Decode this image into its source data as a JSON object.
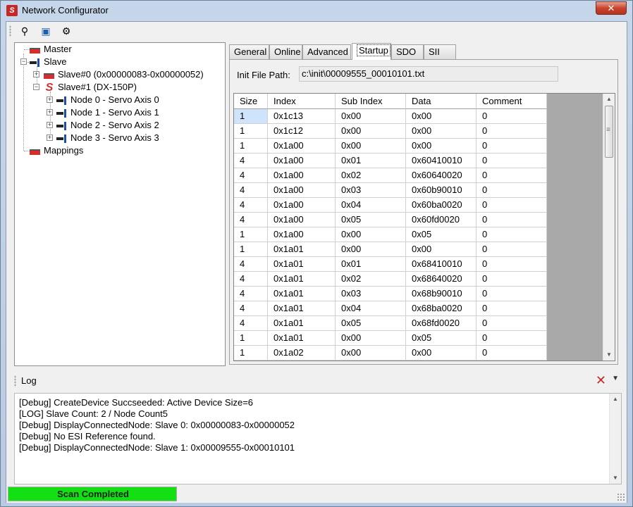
{
  "window": {
    "title": "Network Configurator",
    "close_label": "✕"
  },
  "toolbar": {
    "buttons": [
      {
        "name": "scan-binoculars-icon",
        "glyph": "⚲"
      },
      {
        "name": "image-icon",
        "glyph": "▣"
      },
      {
        "name": "settings-gears-icon",
        "glyph": "⚙"
      }
    ]
  },
  "tree": {
    "master": "Master",
    "slave": "Slave",
    "slave0": "Slave#0 (0x00000083-0x00000052)",
    "slave1": "Slave#1 (DX-150P)",
    "nodes": [
      "Node 0 - Servo Axis 0",
      "Node 1 - Servo Axis 1",
      "Node 2 - Servo Axis 2",
      "Node 3 - Servo Axis 3"
    ],
    "mappings": "Mappings"
  },
  "tabs": [
    "General",
    "Online",
    "Advanced",
    "Startup",
    "SDO",
    "SII"
  ],
  "active_tab": "Startup",
  "startup": {
    "init_file_label": "Init File Path:",
    "init_file_path": "c:\\init\\00009555_00010101.txt",
    "columns": [
      "Size",
      "Index",
      "Sub Index",
      "Data",
      "Comment"
    ],
    "rows": [
      [
        "1",
        "0x1c13",
        "0x00",
        "0x00",
        "0"
      ],
      [
        "1",
        "0x1c12",
        "0x00",
        "0x00",
        "0"
      ],
      [
        "1",
        "0x1a00",
        "0x00",
        "0x00",
        "0"
      ],
      [
        "4",
        "0x1a00",
        "0x01",
        "0x60410010",
        "0"
      ],
      [
        "4",
        "0x1a00",
        "0x02",
        "0x60640020",
        "0"
      ],
      [
        "4",
        "0x1a00",
        "0x03",
        "0x60b90010",
        "0"
      ],
      [
        "4",
        "0x1a00",
        "0x04",
        "0x60ba0020",
        "0"
      ],
      [
        "4",
        "0x1a00",
        "0x05",
        "0x60fd0020",
        "0"
      ],
      [
        "1",
        "0x1a00",
        "0x00",
        "0x05",
        "0"
      ],
      [
        "1",
        "0x1a01",
        "0x00",
        "0x00",
        "0"
      ],
      [
        "4",
        "0x1a01",
        "0x01",
        "0x68410010",
        "0"
      ],
      [
        "4",
        "0x1a01",
        "0x02",
        "0x68640020",
        "0"
      ],
      [
        "4",
        "0x1a01",
        "0x03",
        "0x68b90010",
        "0"
      ],
      [
        "4",
        "0x1a01",
        "0x04",
        "0x68ba0020",
        "0"
      ],
      [
        "4",
        "0x1a01",
        "0x05",
        "0x68fd0020",
        "0"
      ],
      [
        "1",
        "0x1a01",
        "0x00",
        "0x05",
        "0"
      ],
      [
        "1",
        "0x1a02",
        "0x00",
        "0x00",
        "0"
      ]
    ]
  },
  "log": {
    "title": "Log",
    "lines": [
      "[Debug] CreateDevice Succseeded: Active Device Size=6",
      "[LOG] Slave Count: 2 / Node Count5",
      "[Debug] DisplayConnectedNode: Slave 0: 0x00000083-0x00000052",
      "[Debug] No ESI Reference found.",
      "[Debug] DisplayConnectedNode: Slave 1: 0x00009555-0x00010101"
    ]
  },
  "status": {
    "progress_text": "Scan Completed",
    "progress_fraction": 1.0,
    "progress_color": "#13e013"
  }
}
